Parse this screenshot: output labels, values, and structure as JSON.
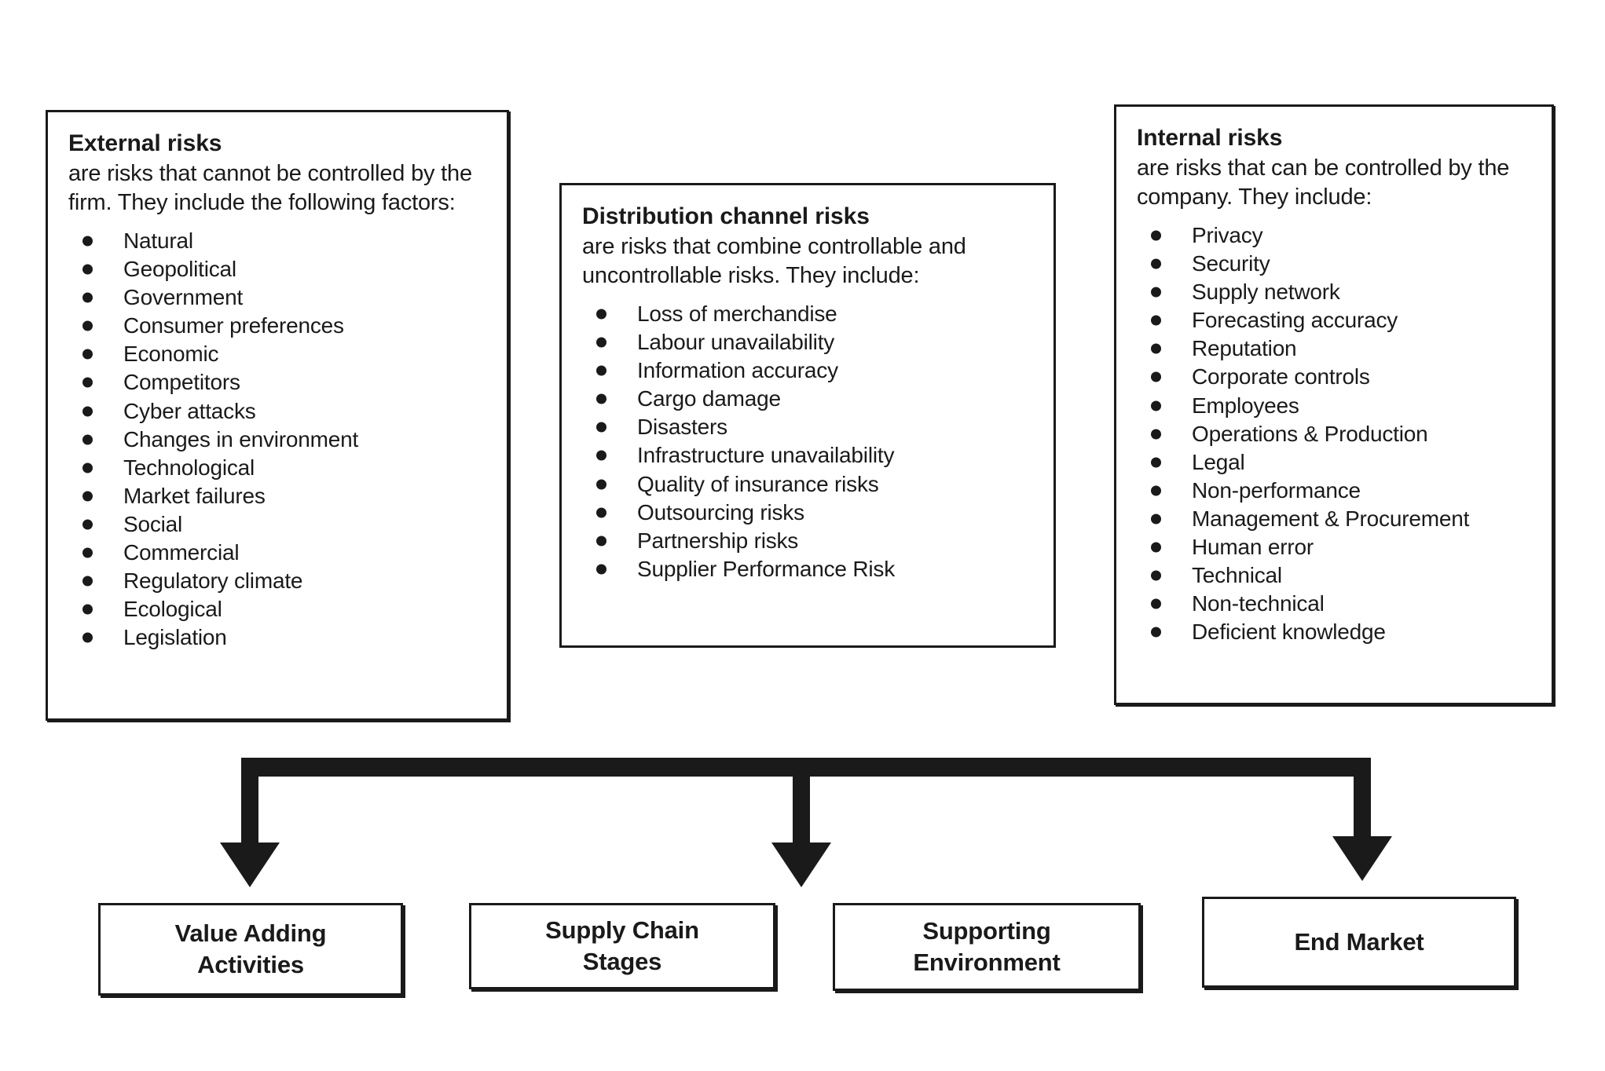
{
  "diagram": {
    "boxes": [
      {
        "id": "external",
        "title": "External risks",
        "description": "are risks that cannot be controlled by the firm. They include the following factors:",
        "items": [
          "Natural",
          "Geopolitical",
          "Government",
          "Consumer preferences",
          "Economic",
          "Competitors",
          "Cyber attacks",
          "Changes in environment",
          "Technological",
          "Market failures",
          "Social",
          "Commercial",
          "Regulatory climate",
          "Ecological",
          "Legislation"
        ]
      },
      {
        "id": "distribution",
        "title": "Distribution channel risks",
        "description": "are risks that combine controllable and uncontrollable risks. They include:",
        "items": [
          "Loss of merchandise",
          "Labour unavailability",
          "Information accuracy",
          "Cargo damage",
          "Disasters",
          "Infrastructure unavailability",
          "Quality of insurance risks",
          "Outsourcing risks",
          "Partnership risks",
          "Supplier Performance Risk"
        ]
      },
      {
        "id": "internal",
        "title": "Internal risks",
        "description": "are risks that can be controlled by the company. They include:",
        "items": [
          "Privacy",
          "Security",
          "Supply network",
          "Forecasting accuracy",
          "Reputation",
          "Corporate controls",
          "Employees",
          "Operations & Production",
          "Legal",
          "Non-performance",
          "Management & Procurement",
          "Human error",
          "Technical",
          "Non-technical",
          "Deficient knowledge"
        ]
      }
    ],
    "stages": [
      {
        "label": "Value Adding\nActivities"
      },
      {
        "label": "Supply Chain\nStages"
      },
      {
        "label": "Supporting\nEnvironment"
      },
      {
        "label": "End Market"
      }
    ],
    "connector": {
      "icon": "down-arrow-icon",
      "arrow_count": 4,
      "color": "#1a1a1a"
    }
  }
}
